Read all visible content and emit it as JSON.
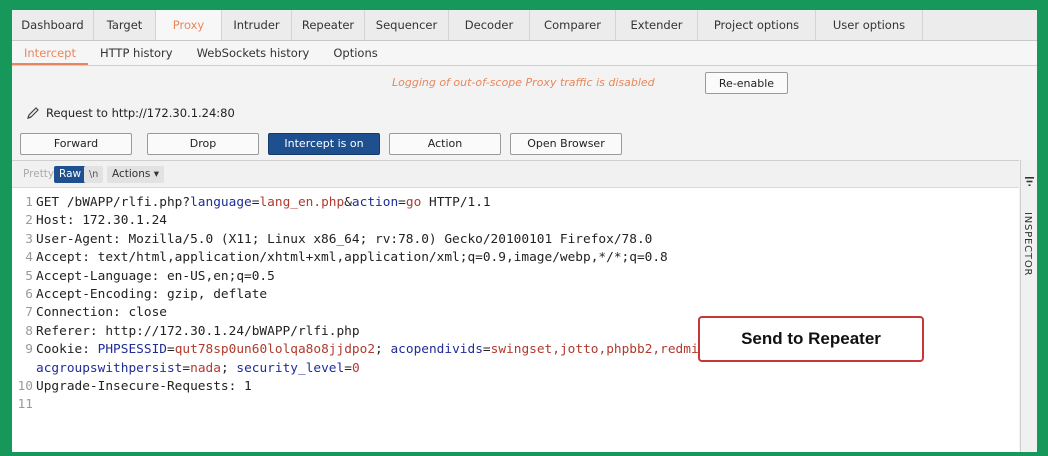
{
  "tabs": [
    "Dashboard",
    "Target",
    "Proxy",
    "Intruder",
    "Repeater",
    "Sequencer",
    "Decoder",
    "Comparer",
    "Extender",
    "Project options",
    "User options"
  ],
  "subtabs": [
    "Intercept",
    "HTTP history",
    "WebSockets history",
    "Options"
  ],
  "notice": "Logging of out-of-scope Proxy traffic is disabled",
  "reenable": "Re-enable",
  "request_to": "Request to http://172.30.1.24:80",
  "buttons": {
    "forward": "Forward",
    "drop": "Drop",
    "intercept": "Intercept is on",
    "action": "Action",
    "open_browser": "Open Browser"
  },
  "editor": {
    "pretty": "Pretty",
    "raw": "Raw",
    "ln": "\\n",
    "actions": "Actions ▾"
  },
  "request_lines": [
    {
      "n": "1",
      "parts": [
        {
          "t": "GET /bWAPP/rlfi.php?",
          "c": ""
        },
        {
          "t": "language",
          "c": "param"
        },
        {
          "t": "=",
          "c": ""
        },
        {
          "t": "lang_en.php",
          "c": "val"
        },
        {
          "t": "&",
          "c": ""
        },
        {
          "t": "action",
          "c": "param"
        },
        {
          "t": "=",
          "c": ""
        },
        {
          "t": "go",
          "c": "val"
        },
        {
          "t": " HTTP/1.1",
          "c": ""
        }
      ]
    },
    {
      "n": "2",
      "parts": [
        {
          "t": "Host: 172.30.1.24",
          "c": ""
        }
      ]
    },
    {
      "n": "3",
      "parts": [
        {
          "t": "User-Agent: Mozilla/5.0 (X11; Linux x86_64; rv:78.0) Gecko/20100101 Firefox/78.0",
          "c": ""
        }
      ]
    },
    {
      "n": "4",
      "parts": [
        {
          "t": "Accept: text/html,application/xhtml+xml,application/xml;q=0.9,image/webp,*/*;q=0.8",
          "c": ""
        }
      ]
    },
    {
      "n": "5",
      "parts": [
        {
          "t": "Accept-Language: en-US,en;q=0.5",
          "c": ""
        }
      ]
    },
    {
      "n": "6",
      "parts": [
        {
          "t": "Accept-Encoding: gzip, deflate",
          "c": ""
        }
      ]
    },
    {
      "n": "7",
      "parts": [
        {
          "t": "Connection: close",
          "c": ""
        }
      ]
    },
    {
      "n": "8",
      "parts": [
        {
          "t": "Referer: http://172.30.1.24/bWAPP/rlfi.php",
          "c": ""
        }
      ]
    },
    {
      "n": "9",
      "parts": [
        {
          "t": "Cookie: ",
          "c": ""
        },
        {
          "t": "PHPSESSID",
          "c": "param"
        },
        {
          "t": "=",
          "c": ""
        },
        {
          "t": "qut78sp0un60lolqa8o8jjdpo2",
          "c": "val"
        },
        {
          "t": "; ",
          "c": ""
        },
        {
          "t": "acopendivids",
          "c": "param"
        },
        {
          "t": "=",
          "c": ""
        },
        {
          "t": "swingset,jotto,phpbb2,redmine",
          "c": "val"
        },
        {
          "t": ";",
          "c": ""
        }
      ]
    },
    {
      "n": "",
      "parts": [
        {
          "t": "acgroupswithpersist",
          "c": "param"
        },
        {
          "t": "=",
          "c": ""
        },
        {
          "t": "nada",
          "c": "val"
        },
        {
          "t": "; ",
          "c": ""
        },
        {
          "t": "security_level",
          "c": "param"
        },
        {
          "t": "=",
          "c": ""
        },
        {
          "t": "0",
          "c": "val"
        }
      ]
    },
    {
      "n": "10",
      "parts": [
        {
          "t": "Upgrade-Insecure-Requests: 1",
          "c": ""
        }
      ]
    },
    {
      "n": "11",
      "parts": []
    }
  ],
  "inspector": "INSPECTOR",
  "callout": "Send to Repeater",
  "colors": {
    "accent": "#e8875d",
    "primary": "#1e4f8f",
    "frame": "#15985a",
    "callout_border": "#c83737"
  }
}
